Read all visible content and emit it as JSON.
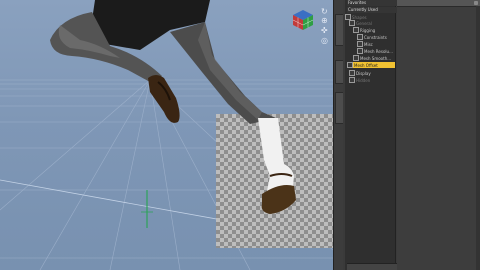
{
  "viewport": {
    "label": "3D viewport",
    "icons": [
      "rotate-icon",
      "zoom-icon",
      "pan-icon",
      "frame-icon"
    ]
  },
  "panel": {
    "headers": [
      "Favorites",
      "Currently Used"
    ],
    "tree": [
      {
        "label": "Shapes",
        "dim": true
      },
      {
        "label": "General",
        "dim": true
      },
      {
        "label": "Rigging",
        "dim": false
      },
      {
        "label": "Constraints",
        "dim": false
      },
      {
        "label": "Misc",
        "dim": false
      },
      {
        "label": "Mesh Resolu...",
        "dim": false
      },
      {
        "label": "Mesh Smooth...",
        "dim": false
      },
      {
        "label": "Mesh Offset",
        "dim": false,
        "selected": true
      },
      {
        "label": "Display",
        "dim": false
      },
      {
        "label": "Hidden",
        "dim": true
      }
    ]
  }
}
